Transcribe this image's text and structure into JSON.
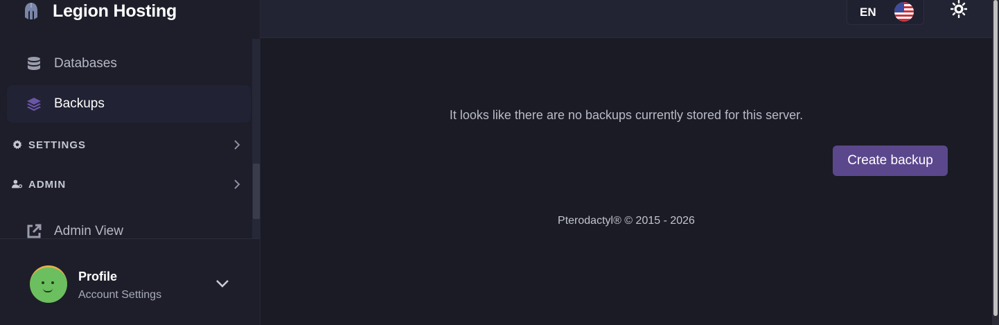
{
  "brand": {
    "title": "Legion Hosting",
    "logo_icon": "spartan-helmet-icon"
  },
  "sidebar": {
    "items": [
      {
        "label": "Databases",
        "icon": "database-icon",
        "active": false
      },
      {
        "label": "Backups",
        "icon": "layers-icon",
        "active": true
      }
    ],
    "sections": [
      {
        "label": "SETTINGS",
        "icon": "gear-icon"
      },
      {
        "label": "ADMIN",
        "icon": "user-key-icon"
      }
    ],
    "admin_view": {
      "label": "Admin View",
      "icon": "external-link-icon"
    }
  },
  "profile": {
    "name": "Profile",
    "subtitle": "Account Settings"
  },
  "topbar": {
    "language_code": "EN",
    "flag": "us-flag-icon",
    "theme_icon": "sun-icon"
  },
  "main": {
    "empty_message": "It looks like there are no backups currently stored for this server.",
    "create_button": "Create backup",
    "footer": "Pterodactyl® © 2015 - 2026"
  },
  "colors": {
    "accent": "#5b478c",
    "background": "#1a1b24",
    "sidebar": "#1d1e2a"
  }
}
